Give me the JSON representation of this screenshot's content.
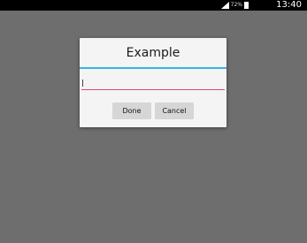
{
  "status_bar": {
    "battery_percent": "72%",
    "time": "13:40"
  },
  "dialog": {
    "title": "Example",
    "input": {
      "value": "",
      "placeholder": ""
    },
    "buttons": {
      "done_label": "Done",
      "cancel_label": "Cancel"
    }
  },
  "colors": {
    "title_divider": "#33b5e5",
    "input_underline": "#e8417f",
    "dim_background": "#6e6e6e"
  }
}
